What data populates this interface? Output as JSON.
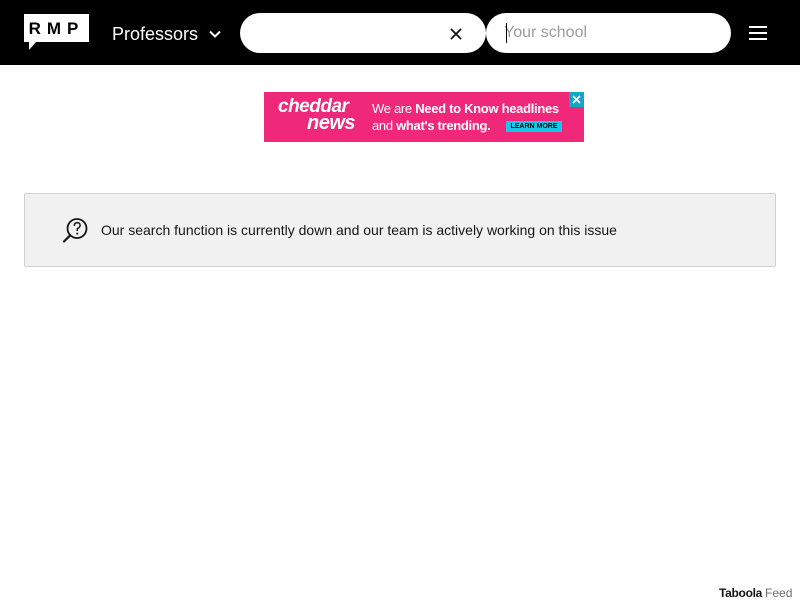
{
  "header": {
    "logo_text": "RMP",
    "search_type": {
      "label": "Professors",
      "icon": "chevron-down-icon"
    },
    "professor_search": {
      "value": "",
      "clear_icon": "close-icon"
    },
    "school_search": {
      "placeholder": "Your school"
    },
    "menu_icon": "hamburger-menu-icon"
  },
  "ad": {
    "brand_top": "cheddar",
    "brand_bottom": "news",
    "line1_pre": "We are ",
    "line1_bold": "Need to Know headlines",
    "line2_pre": "and ",
    "line2_bold": "what's trending.",
    "cta": "LEARN MORE",
    "colors": {
      "background": "#f0287a",
      "cta": "#19c8e8"
    }
  },
  "notice": {
    "icon": "magnifier-question-icon",
    "message": "Our search function is currently down and our team is actively working on this issue"
  },
  "footer": {
    "taboola_brand": "Taboola",
    "taboola_feed": "Feed"
  },
  "colors": {
    "header_bg": "#000000",
    "notice_bg": "#f1f1f1",
    "text": "#151515"
  }
}
